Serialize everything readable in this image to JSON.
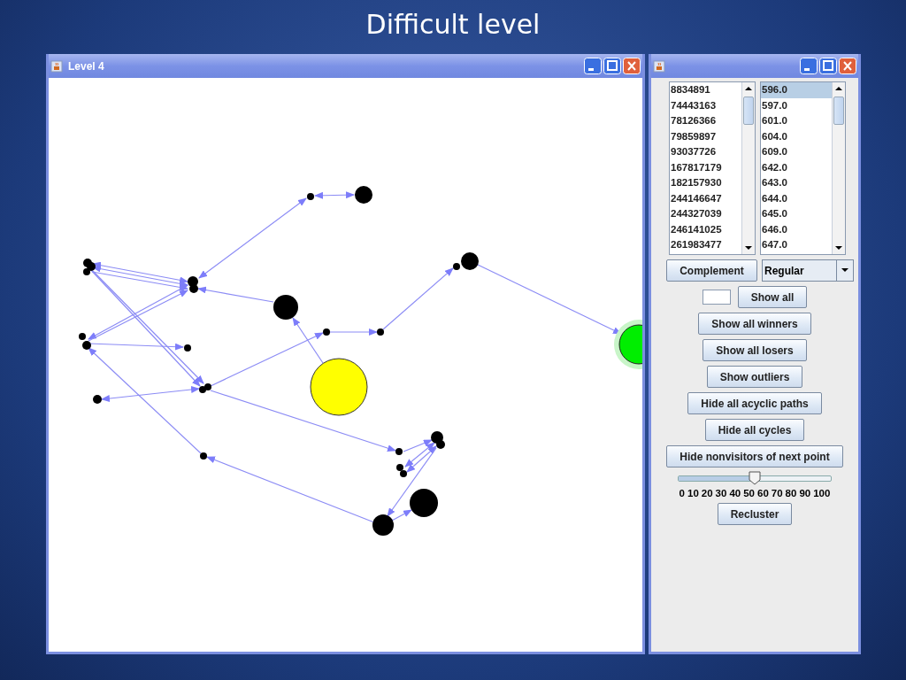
{
  "slide": {
    "title": "Difficult level"
  },
  "graph_window": {
    "title": "Level 4"
  },
  "control_window": {
    "id_list": [
      {
        "text": "8834891",
        "selected": false
      },
      {
        "text": "74443163",
        "selected": false
      },
      {
        "text": "78126366",
        "selected": false
      },
      {
        "text": "79859897",
        "selected": false
      },
      {
        "text": "93037726",
        "selected": false
      },
      {
        "text": "167817179",
        "selected": false
      },
      {
        "text": "182157930",
        "selected": false
      },
      {
        "text": "244146647",
        "selected": false
      },
      {
        "text": "244327039",
        "selected": false
      },
      {
        "text": "246141025",
        "selected": false
      },
      {
        "text": "261983477",
        "selected": false
      }
    ],
    "value_list": [
      {
        "text": "596.0",
        "selected": true
      },
      {
        "text": "597.0",
        "selected": false
      },
      {
        "text": "601.0",
        "selected": false
      },
      {
        "text": "604.0",
        "selected": false
      },
      {
        "text": "609.0",
        "selected": false
      },
      {
        "text": "642.0",
        "selected": false
      },
      {
        "text": "643.0",
        "selected": false
      },
      {
        "text": "644.0",
        "selected": false
      },
      {
        "text": "645.0",
        "selected": false
      },
      {
        "text": "646.0",
        "selected": false
      },
      {
        "text": "647.0",
        "selected": false
      }
    ],
    "complement_button": "Complement",
    "mode_dropdown": {
      "value": "Regular"
    },
    "show_all_button": "Show all",
    "buttons": [
      "Show all winners",
      "Show all losers",
      "Show outliers",
      "Hide all acyclic paths",
      "Hide all cycles",
      "Hide nonvisitors of next point"
    ],
    "slider": {
      "level": 0.5,
      "tick_labels": [
        "0",
        "10",
        "20",
        "30",
        "40",
        "50",
        "60",
        "70",
        "80",
        "90",
        "100"
      ]
    },
    "recluster_button": "Recluster"
  }
}
